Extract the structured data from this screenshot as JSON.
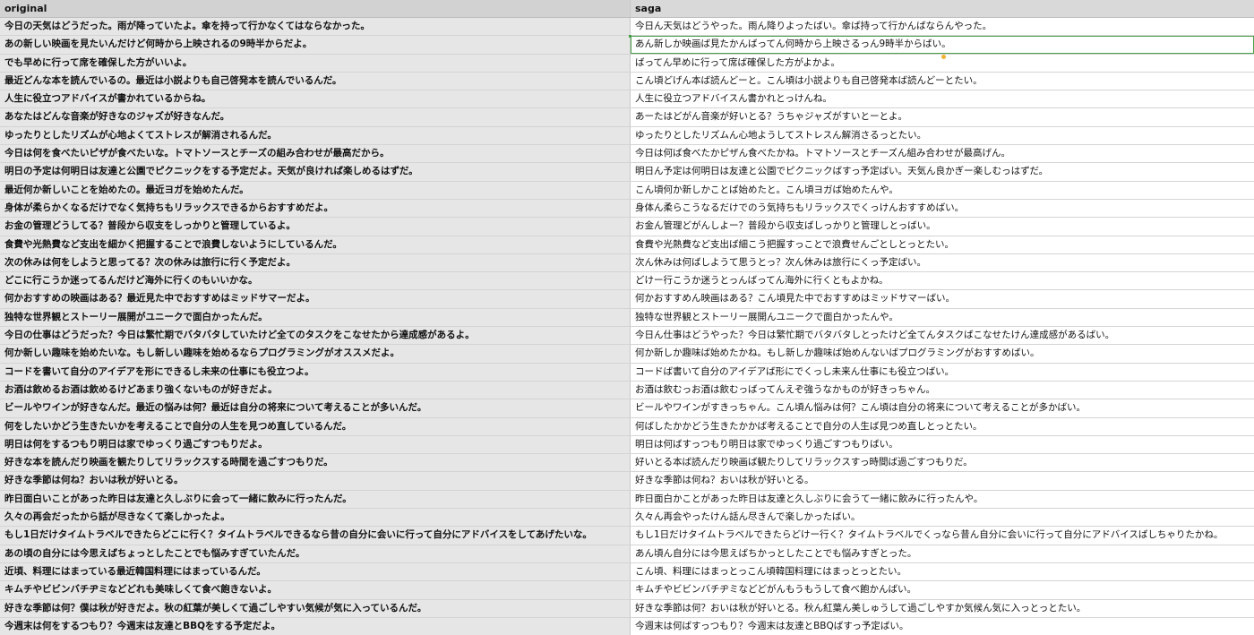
{
  "colors": {
    "header_bg": "#d2d2d2",
    "original_bg": "#e6e6e6",
    "saga_bg": "#ffffff",
    "selection": "#4aa04a",
    "fill_handle": "#f2b233"
  },
  "header": {
    "original": "original",
    "saga": "saga"
  },
  "rows": [
    {
      "original": "今日の天気はどうだった。雨が降っていたよ。傘を持って行かなくてはならなかった。",
      "saga": "今日ん天気はどうやった。雨ん降りよったばい。傘ば持って行かんばならんやった。"
    },
    {
      "original": "あの新しい映画を見たいんだけど何時から上映されるの9時半からだよ。",
      "saga": "あん新しか映画ば見たかんばってん何時から上映さるっん9時半からばい。"
    },
    {
      "original": "でも早めに行って席を確保した方がいいよ。",
      "saga": "ばってん早めに行って席ば確保した方がよかよ。"
    },
    {
      "original": "最近どんな本を読んでいるの。最近は小説よりも自己啓発本を読んでいるんだ。",
      "saga": "こん頃どげん本ば読んどーと。こん頃は小説よりも自己啓発本ば読んどーとたい。"
    },
    {
      "original": "人生に役立つアドバイスが書かれているからね。",
      "saga": "人生に役立つアドバイスん書かれとっけんね。"
    },
    {
      "original": "あなたはどんな音楽が好きなのジャズが好きなんだ。",
      "saga": "あーたはどがん音楽が好いとる？うちゃジャズがすいとーとよ。"
    },
    {
      "original": "ゆったりとしたリズムが心地よくてストレスが解消されるんだ。",
      "saga": "ゆったりとしたリズムん心地ようしてストレスん解消さるっとたい。"
    },
    {
      "original": "今日は何を食べたいピザが食べたいな。トマトソースとチーズの組み合わせが最高だから。",
      "saga": "今日は何ば食べたかピザん食べたかね。トマトソースとチーズん組み合わせが最高げん。"
    },
    {
      "original": "明日の予定は何明日は友達と公園でピクニックをする予定だよ。天気が良ければ楽しめるはずだ。",
      "saga": "明日ん予定は何明日は友達と公園でピクニックばすっ予定ばい。天気ん良かぎー楽しむっはずだ。"
    },
    {
      "original": "最近何か新しいことを始めたの。最近ヨガを始めたんだ。",
      "saga": "こん頃何か新しかことば始めたと。こん頃ヨガば始めたんや。"
    },
    {
      "original": "身体が柔らかくなるだけでなく気持ちもリラックスできるからおすすめだよ。",
      "saga": "身体ん柔らこうなるだけでのう気持ちもリラックスでくっけんおすすめばい。"
    },
    {
      "original": "お金の管理どうしてる？普段から収支をしっかりと管理しているよ。",
      "saga": "お金ん管理どがんしよー？普段から収支ばしっかりと管理しとっばい。"
    },
    {
      "original": "食費や光熱費など支出を細かく把握することで浪費しないようにしているんだ。",
      "saga": "食費や光熱費など支出ば細こう把握すっことで浪費せんごとしとっとたい。"
    },
    {
      "original": "次の休みは何をしようと思ってる？次の休みは旅行に行く予定だよ。",
      "saga": "次ん休みは何ばしようて思うとっ？次ん休みは旅行にくっ予定ばい。"
    },
    {
      "original": "どこに行こうか迷ってるんだけど海外に行くのもいいかな。",
      "saga": "どけー行こうか迷うとっんばってん海外に行くともよかね。"
    },
    {
      "original": "何かおすすめの映画はある？最近見た中でおすすめはミッドサマーだよ。",
      "saga": "何かおすすめん映画はある？こん頃見た中でおすすめはミッドサマーばい。"
    },
    {
      "original": "独特な世界観とストーリー展開がユニークで面白かったんだ。",
      "saga": "独特な世界観とストーリー展開んユニークで面白かったんや。"
    },
    {
      "original": "今日の仕事はどうだった？今日は繁忙期でバタバタしていたけど全てのタスクをこなせたから達成感があるよ。",
      "saga": "今日ん仕事はどうやった？今日は繁忙期でバタバタしとったけど全てんタスクばこなせたけん達成感があるばい。"
    },
    {
      "original": "何か新しい趣味を始めたいな。もし新しい趣味を始めるならプログラミングがオススメだよ。",
      "saga": "何か新しか趣味ば始めたかね。もし新しか趣味ば始めんないばプログラミングがおすすめばい。"
    },
    {
      "original": "コードを書いて自分のアイデアを形にできるし未来の仕事にも役立つよ。",
      "saga": "コードば書いて自分のアイデアば形にでくっし未来ん仕事にも役立つばい。"
    },
    {
      "original": "お酒は飲めるお酒は飲めるけどあまり強くないものが好きだよ。",
      "saga": "お酒は飲むっお酒は飲むっばってんえぞ強うなかものが好きっちゃん。"
    },
    {
      "original": "ビールやワインが好きなんだ。最近の悩みは何？最近は自分の将来について考えることが多いんだ。",
      "saga": "ビールやワインがすきっちゃん。こん頃ん悩みは何？こん頃は自分の将来について考えることが多かばい。"
    },
    {
      "original": "何をしたいかどう生きたいかを考えることで自分の人生を見つめ直しているんだ。",
      "saga": "何ばしたかかどう生きたかかば考えることで自分の人生ば見つめ直しとっとたい。"
    },
    {
      "original": "明日は何をするつもり明日は家でゆっくり過ごすつもりだよ。",
      "saga": "明日は何ばすっつもり明日は家でゆっくり過ごすつもりばい。"
    },
    {
      "original": "好きな本を読んだり映画を観たりしてリラックスする時間を過ごすつもりだ。",
      "saga": "好いとる本ば読んだり映画ば観たりしてリラックスすっ時間ば過ごすつもりだ。"
    },
    {
      "original": "好きな季節は何ね？おいは秋が好いとる。",
      "saga": "好きな季節は何ね？おいは秋が好いとる。"
    },
    {
      "original": "昨日面白いことがあった昨日は友達と久しぶりに会って一緒に飲みに行ったんだ。",
      "saga": "昨日面白かことがあった昨日は友達と久しぶりに会うて一緒に飲みに行ったんや。"
    },
    {
      "original": "久々の再会だったから話が尽きなくて楽しかったよ。",
      "saga": "久々ん再会やったけん話ん尽きんで楽しかったばい。"
    },
    {
      "original": "もし1日だけタイムトラベルできたらどこに行く？タイムトラベルできるなら昔の自分に会いに行って自分にアドバイスをしてあげたいな。",
      "saga": "もし1日だけタイムトラベルできたらどけー行く？タイムトラベルでくっなら昔ん自分に会いに行って自分にアドバイスばしちゃりたかね。"
    },
    {
      "original": "あの頃の自分には今思えばちょっとしたことでも悩みすぎていたんだ。",
      "saga": "あん頃ん自分には今思えばちかっとしたことでも悩みすぎとった。"
    },
    {
      "original": "近頃、料理にはまっている最近韓国料理にはまっているんだ。",
      "saga": "こん頃、料理にはまっとっこん頃韓国料理にはまっとっとたい。"
    },
    {
      "original": "キムチやビビンバチヂミなどどれも美味しくて食べ飽きないよ。",
      "saga": "キムチやビビンバチヂミなどどがんもうもうして食べ飽かんばい。"
    },
    {
      "original": "好きな季節は何？僕は秋が好きだよ。秋の紅葉が美しくて過ごしやすい気候が気に入っているんだ。",
      "saga": "好きな季節は何？おいは秋が好いとる。秋ん紅葉ん美しゅうして過ごしやすか気候ん気に入っとっとたい。"
    },
    {
      "original": "今週末は何をするつもり？今週末は友達とBBQをする予定だよ。",
      "saga": "今週末は何ばすっつもり？今週末は友達とBBQばすっ予定ばい。"
    }
  ]
}
